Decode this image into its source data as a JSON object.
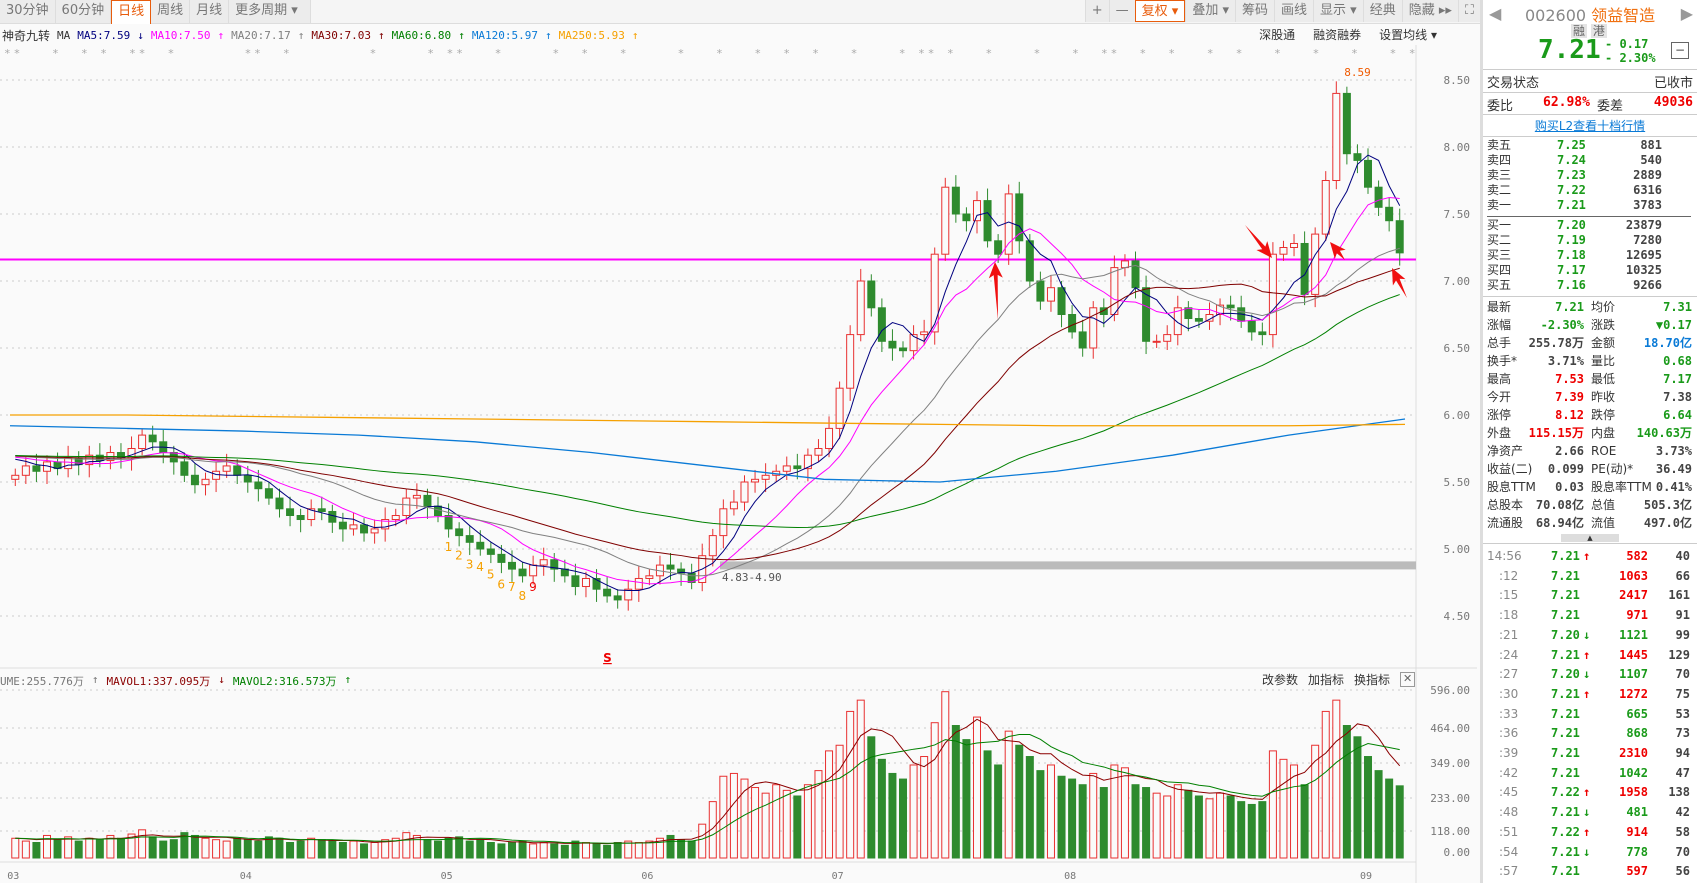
{
  "toolbar": {
    "period_tabs": [
      "30分钟",
      "60分钟",
      "日线",
      "周线",
      "月线",
      "更多周期 ▾"
    ],
    "active_period": "日线",
    "tools": [
      "+",
      "—",
      "复权 ▾",
      "叠加 ▾",
      "筹码",
      "画线",
      "显示 ▾",
      "经典",
      "隐藏 ▸▸",
      "⛶"
    ],
    "active_tool": "复权 ▾"
  },
  "legend": {
    "indicator": "神奇九转",
    "ma": "MA",
    "items": [
      {
        "text": "MA5:7.59",
        "arrow": "↓",
        "color": "#00007f"
      },
      {
        "text": "MA10:7.50",
        "arrow": "↑",
        "color": "#ff00ff"
      },
      {
        "text": "MA20:7.17",
        "arrow": "↑",
        "color": "#808080"
      },
      {
        "text": "MA30:7.03",
        "arrow": "↑",
        "color": "#7f0000"
      },
      {
        "text": "MA60:6.80",
        "arrow": "↑",
        "color": "#008000"
      },
      {
        "text": "MA120:5.97",
        "arrow": "↑",
        "color": "#0a7ad6"
      },
      {
        "text": "MA250:5.93",
        "arrow": "↑",
        "color": "#f5a000"
      }
    ],
    "links": [
      "深股通",
      "融资融券",
      "设置均线 ▾"
    ]
  },
  "signal_row": "**   *  * *  **  *       **  *        *     * **   *     *  *   *     *   *   *  *  *   *    * ** *   *    *   *  **  *  *   *  *   *   *   *   * *",
  "volume_panel": {
    "volume_label": "UME:255.776万",
    "volume_arrow": "↑",
    "mavol1": "MAVOL1:337.095万",
    "mavol1_arrow": "↓",
    "mavol2": "MAVOL2:316.573万",
    "mavol2_arrow": "↑",
    "tools": [
      "改参数",
      "加指标",
      "换指标"
    ],
    "close": "✕"
  },
  "chart_data": {
    "type": "candlestick",
    "price_ticks": [
      "8.50",
      "8.00",
      "7.50",
      "7.00",
      "6.50",
      "6.00",
      "5.50",
      "5.00",
      "4.50"
    ],
    "price_range": [
      4.3,
      8.75
    ],
    "volume_ticks": [
      "596.00",
      "464.00",
      "349.00",
      "233.00",
      "118.00",
      "0.00"
    ],
    "volume_range": [
      0,
      596
    ],
    "month_labels": [
      "03",
      "04",
      "05",
      "06",
      "07",
      "08",
      "09"
    ],
    "month_start_index": [
      0,
      22,
      41,
      60,
      78,
      100,
      128
    ],
    "close": [
      5.55,
      5.62,
      5.58,
      5.65,
      5.6,
      5.68,
      5.63,
      5.7,
      5.66,
      5.72,
      5.68,
      5.75,
      5.85,
      5.8,
      5.72,
      5.65,
      5.55,
      5.48,
      5.52,
      5.58,
      5.62,
      5.55,
      5.5,
      5.45,
      5.38,
      5.3,
      5.25,
      5.22,
      5.3,
      5.28,
      5.2,
      5.15,
      5.18,
      5.12,
      5.15,
      5.22,
      5.25,
      5.38,
      5.4,
      5.32,
      5.25,
      5.15,
      5.1,
      5.05,
      5.0,
      4.96,
      4.9,
      4.85,
      4.8,
      4.88,
      4.92,
      4.85,
      4.8,
      4.72,
      4.78,
      4.7,
      4.65,
      4.62,
      4.7,
      4.78,
      4.8,
      4.88,
      4.85,
      4.82,
      4.75,
      4.95,
      5.1,
      5.3,
      5.35,
      5.5,
      5.52,
      5.55,
      5.58,
      5.62,
      5.6,
      5.7,
      5.75,
      5.9,
      6.2,
      6.6,
      7.0,
      6.8,
      6.55,
      6.5,
      6.48,
      6.6,
      6.62,
      7.2,
      7.7,
      7.5,
      7.45,
      7.6,
      7.3,
      7.2,
      7.65,
      7.3,
      7.0,
      6.85,
      6.95,
      6.75,
      6.62,
      6.5,
      6.8,
      6.75,
      7.1,
      7.15,
      6.95,
      6.55,
      6.55,
      6.6,
      6.8,
      6.72,
      6.7,
      6.75,
      6.82,
      6.8,
      6.7,
      6.62,
      6.6,
      7.2,
      7.25,
      7.28,
      6.9,
      7.35,
      7.75,
      8.4,
      7.95,
      7.9,
      7.7,
      7.55,
      7.45,
      7.21
    ],
    "volume": [
      70,
      60,
      55,
      80,
      65,
      75,
      60,
      70,
      65,
      80,
      70,
      85,
      100,
      75,
      60,
      65,
      90,
      80,
      70,
      65,
      60,
      70,
      65,
      60,
      75,
      70,
      55,
      60,
      70,
      65,
      60,
      55,
      60,
      50,
      55,
      65,
      70,
      90,
      80,
      65,
      60,
      70,
      75,
      60,
      65,
      55,
      50,
      55,
      60,
      50,
      55,
      50,
      45,
      60,
      55,
      50,
      45,
      55,
      60,
      55,
      60,
      70,
      80,
      65,
      60,
      120,
      200,
      290,
      300,
      280,
      250,
      230,
      260,
      240,
      220,
      260,
      310,
      380,
      400,
      520,
      560,
      430,
      350,
      300,
      280,
      330,
      360,
      480,
      590,
      470,
      420,
      500,
      380,
      330,
      450,
      400,
      360,
      310,
      330,
      290,
      280,
      260,
      300,
      250,
      330,
      320,
      260,
      250,
      230,
      220,
      260,
      240,
      220,
      210,
      230,
      220,
      200,
      190,
      200,
      380,
      350,
      330,
      260,
      400,
      520,
      560,
      470,
      430,
      360,
      310,
      280,
      256
    ],
    "ma120": [
      5.92,
      5.9,
      5.88,
      5.85,
      5.8,
      5.72,
      5.62,
      5.52,
      5.5,
      5.58,
      5.7,
      5.85,
      5.97
    ],
    "ma250": [
      6.0,
      6.0,
      5.99,
      5.98,
      5.97,
      5.96,
      5.95,
      5.94,
      5.93,
      5.92,
      5.92,
      5.92,
      5.93
    ],
    "support_line": 7.16,
    "gap_band_label": "4.83-4.90",
    "gap_band": [
      4.83,
      4.9
    ],
    "high_label": "8.59",
    "high_value": 8.59,
    "nine_turn": [
      "1",
      "2",
      "3",
      "4",
      "5",
      "6",
      "7",
      "8",
      "9"
    ],
    "nine_turn_start_index": 41,
    "s_marker": "S",
    "s_marker_index": 56
  },
  "quote": {
    "code": "002600",
    "name": "领益智造",
    "badges": [
      "融",
      "港"
    ],
    "price": "7.21",
    "change": "- 0.17",
    "change_pct": "- 2.30%",
    "status_label": "交易状态",
    "status_value": "已收市",
    "wb_label": "委比",
    "wb_value": "62.98%",
    "wc_label": "委差",
    "wc_value": "49036",
    "l2_link": "购买L2查看十档行情",
    "sells": [
      {
        "label": "卖五",
        "price": "7.25",
        "vol": "881"
      },
      {
        "label": "卖四",
        "price": "7.24",
        "vol": "540"
      },
      {
        "label": "卖三",
        "price": "7.23",
        "vol": "2889"
      },
      {
        "label": "卖二",
        "price": "7.22",
        "vol": "6316"
      },
      {
        "label": "卖一",
        "price": "7.21",
        "vol": "3783"
      }
    ],
    "buys": [
      {
        "label": "买一",
        "price": "7.20",
        "vol": "23879"
      },
      {
        "label": "买二",
        "price": "7.19",
        "vol": "7280"
      },
      {
        "label": "买三",
        "price": "7.18",
        "vol": "12695"
      },
      {
        "label": "买四",
        "price": "7.17",
        "vol": "10325"
      },
      {
        "label": "买五",
        "price": "7.16",
        "vol": "9266"
      }
    ],
    "stats": [
      {
        "l1": "最新",
        "v1": "7.21",
        "c1": "g",
        "l2": "均价",
        "v2": "7.31",
        "c2": "g"
      },
      {
        "l1": "涨幅",
        "v1": "-2.30%",
        "c1": "g",
        "l2": "涨跌",
        "v2": "▼0.17",
        "c2": "g"
      },
      {
        "l1": "总手",
        "v1": "255.78万",
        "c1": "k",
        "l2": "金额",
        "v2": "18.70亿",
        "c2": "bl"
      },
      {
        "l1": "换手*",
        "v1": "3.71%",
        "c1": "k",
        "l2": "量比",
        "v2": "0.68",
        "c2": "g"
      },
      {
        "l1": "最高",
        "v1": "7.53",
        "c1": "r",
        "l2": "最低",
        "v2": "7.17",
        "c2": "g"
      },
      {
        "l1": "今开",
        "v1": "7.39",
        "c1": "r",
        "l2": "昨收",
        "v2": "7.38",
        "c2": "k"
      },
      {
        "l1": "涨停",
        "v1": "8.12",
        "c1": "r",
        "l2": "跌停",
        "v2": "6.64",
        "c2": "g"
      },
      {
        "l1": "外盘",
        "v1": "115.15万",
        "c1": "r",
        "l2": "内盘",
        "v2": "140.63万",
        "c2": "g"
      },
      {
        "l1": "净资产",
        "v1": "2.66",
        "c1": "k",
        "l2": "ROE",
        "v2": "3.73%",
        "c2": "k"
      },
      {
        "l1": "收益(二)",
        "v1": "0.099",
        "c1": "k",
        "l2": "PE(动)*",
        "v2": "36.49",
        "c2": "k"
      },
      {
        "l1": "股息TTM",
        "v1": "0.03",
        "c1": "k",
        "l2": "股息率TTM",
        "v2": "0.41%",
        "c2": "k"
      },
      {
        "l1": "总股本",
        "v1": "70.08亿",
        "c1": "k",
        "l2": "总值",
        "v2": "505.3亿",
        "c2": "k"
      },
      {
        "l1": "流通股",
        "v1": "68.94亿",
        "c1": "k",
        "l2": "流值",
        "v2": "497.0亿",
        "c2": "k"
      }
    ],
    "ticks": [
      {
        "t": "14:56",
        "p": "7.21",
        "a": "↑",
        "v": "582",
        "vc": "r",
        "n": "40"
      },
      {
        "t": ":12",
        "p": "7.21",
        "a": "",
        "v": "1063",
        "vc": "r",
        "n": "66"
      },
      {
        "t": ":15",
        "p": "7.21",
        "a": "",
        "v": "2417",
        "vc": "r",
        "n": "161"
      },
      {
        "t": ":18",
        "p": "7.21",
        "a": "",
        "v": "971",
        "vc": "r",
        "n": "91"
      },
      {
        "t": ":21",
        "p": "7.20",
        "a": "↓",
        "v": "1121",
        "vc": "g",
        "n": "99"
      },
      {
        "t": ":24",
        "p": "7.21",
        "a": "↑",
        "v": "1445",
        "vc": "r",
        "n": "129"
      },
      {
        "t": ":27",
        "p": "7.20",
        "a": "↓",
        "v": "1107",
        "vc": "g",
        "n": "70"
      },
      {
        "t": ":30",
        "p": "7.21",
        "a": "↑",
        "v": "1272",
        "vc": "r",
        "n": "75"
      },
      {
        "t": ":33",
        "p": "7.21",
        "a": "",
        "v": "665",
        "vc": "g",
        "n": "53"
      },
      {
        "t": ":36",
        "p": "7.21",
        "a": "",
        "v": "868",
        "vc": "g",
        "n": "73"
      },
      {
        "t": ":39",
        "p": "7.21",
        "a": "",
        "v": "2310",
        "vc": "r",
        "n": "94"
      },
      {
        "t": ":42",
        "p": "7.21",
        "a": "",
        "v": "1042",
        "vc": "g",
        "n": "47"
      },
      {
        "t": ":45",
        "p": "7.22",
        "a": "↑",
        "v": "1958",
        "vc": "r",
        "n": "138"
      },
      {
        "t": ":48",
        "p": "7.21",
        "a": "↓",
        "v": "481",
        "vc": "g",
        "n": "42"
      },
      {
        "t": ":51",
        "p": "7.22",
        "a": "↑",
        "v": "914",
        "vc": "r",
        "n": "58"
      },
      {
        "t": ":54",
        "p": "7.21",
        "a": "↓",
        "v": "778",
        "vc": "g",
        "n": "70"
      },
      {
        "t": ":57",
        "p": "7.21",
        "a": "",
        "v": "597",
        "vc": "r",
        "n": "56"
      }
    ]
  }
}
